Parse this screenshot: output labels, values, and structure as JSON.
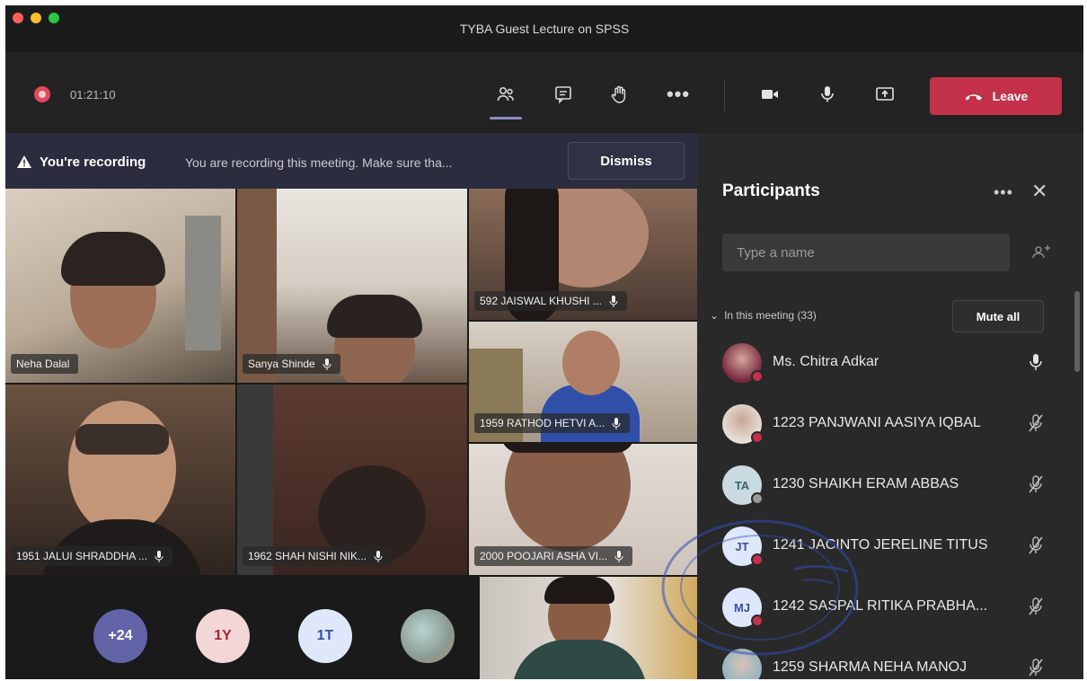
{
  "window": {
    "title": "TYBA Guest Lecture on SPSS"
  },
  "toolbar": {
    "timer": "01:21:10",
    "leave_label": "Leave"
  },
  "banner": {
    "title": "You're recording",
    "message": "You are recording this meeting. Make sure tha...",
    "dismiss_label": "Dismiss"
  },
  "tiles": [
    {
      "name": "Neha Dalal"
    },
    {
      "name": "Sanya Shinde"
    },
    {
      "name": "592 JAISWAL KHUSHI ..."
    },
    {
      "name": "1959 RATHOD HETVI A..."
    },
    {
      "name": "1951 JALUI SHRADDHA ..."
    },
    {
      "name": "1962 SHAH NISHI NIK..."
    },
    {
      "name": "2000 POOJARI ASHA VI..."
    }
  ],
  "overflow_avatars": [
    {
      "label": "+24",
      "bg": "#6264a7",
      "color": "#ffffff"
    },
    {
      "label": "1Y",
      "bg": "#f3d6d8",
      "color": "#a4262c"
    },
    {
      "label": "1T",
      "bg": "#dfe8fb",
      "color": "#3b4fa0"
    }
  ],
  "panel": {
    "title": "Participants",
    "search_placeholder": "Type a name",
    "section_label": "In this meeting (33)",
    "mute_all_label": "Mute all",
    "participants": [
      {
        "name": "Ms. Chitra Adkar",
        "initials": "",
        "mic": "on"
      },
      {
        "name": "1223 PANJWANI AASIYA IQBAL",
        "initials": "",
        "mic": "muted"
      },
      {
        "name": "1230 SHAIKH ERAM ABBAS",
        "initials": "TA",
        "mic": "muted"
      },
      {
        "name": "1241 JACINTO JERELINE TITUS",
        "initials": "JT",
        "mic": "muted"
      },
      {
        "name": "1242 SASPAL RITIKA PRABHA...",
        "initials": "MJ",
        "mic": "muted"
      },
      {
        "name": "1259 SHARMA NEHA MANOJ",
        "initials": "",
        "mic": "muted"
      }
    ]
  },
  "colors": {
    "leave": "#c4314b",
    "accent": "#6264a7",
    "banner_bg": "#2b2d3f"
  }
}
